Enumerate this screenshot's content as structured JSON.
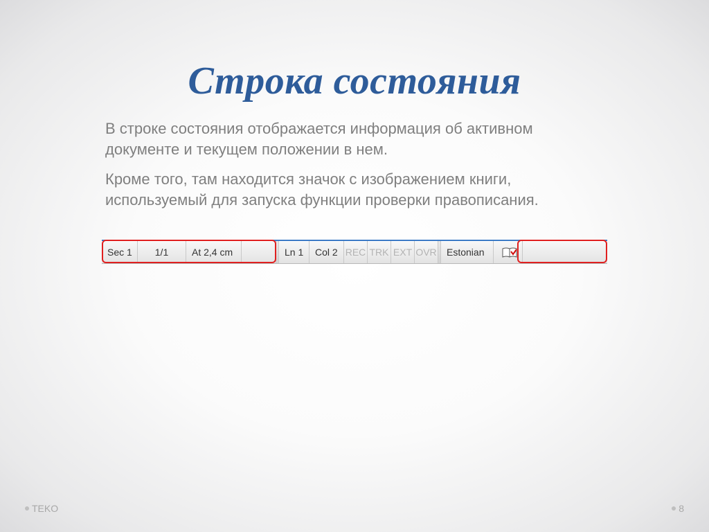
{
  "title": "Строка состояния",
  "paragraphs": {
    "p1": "В строке состояния отображается информация об активном документе и текущем положении в нем.",
    "p2": "Кроме того, там находится значок с изображением книги, используемый для запуска функции проверки правописания."
  },
  "statusbar": {
    "section": "Sec 1",
    "page": "1/1",
    "at": "At 2,4 cm",
    "line": "Ln 1",
    "column": "Col 2",
    "modes": {
      "rec": "REC",
      "trk": "TRK",
      "ext": "EXT",
      "ovr": "OVR"
    },
    "language": "Estonian",
    "spell_icon": "book-spellcheck"
  },
  "footer": {
    "brand": "TEKO",
    "page_number": "8"
  }
}
